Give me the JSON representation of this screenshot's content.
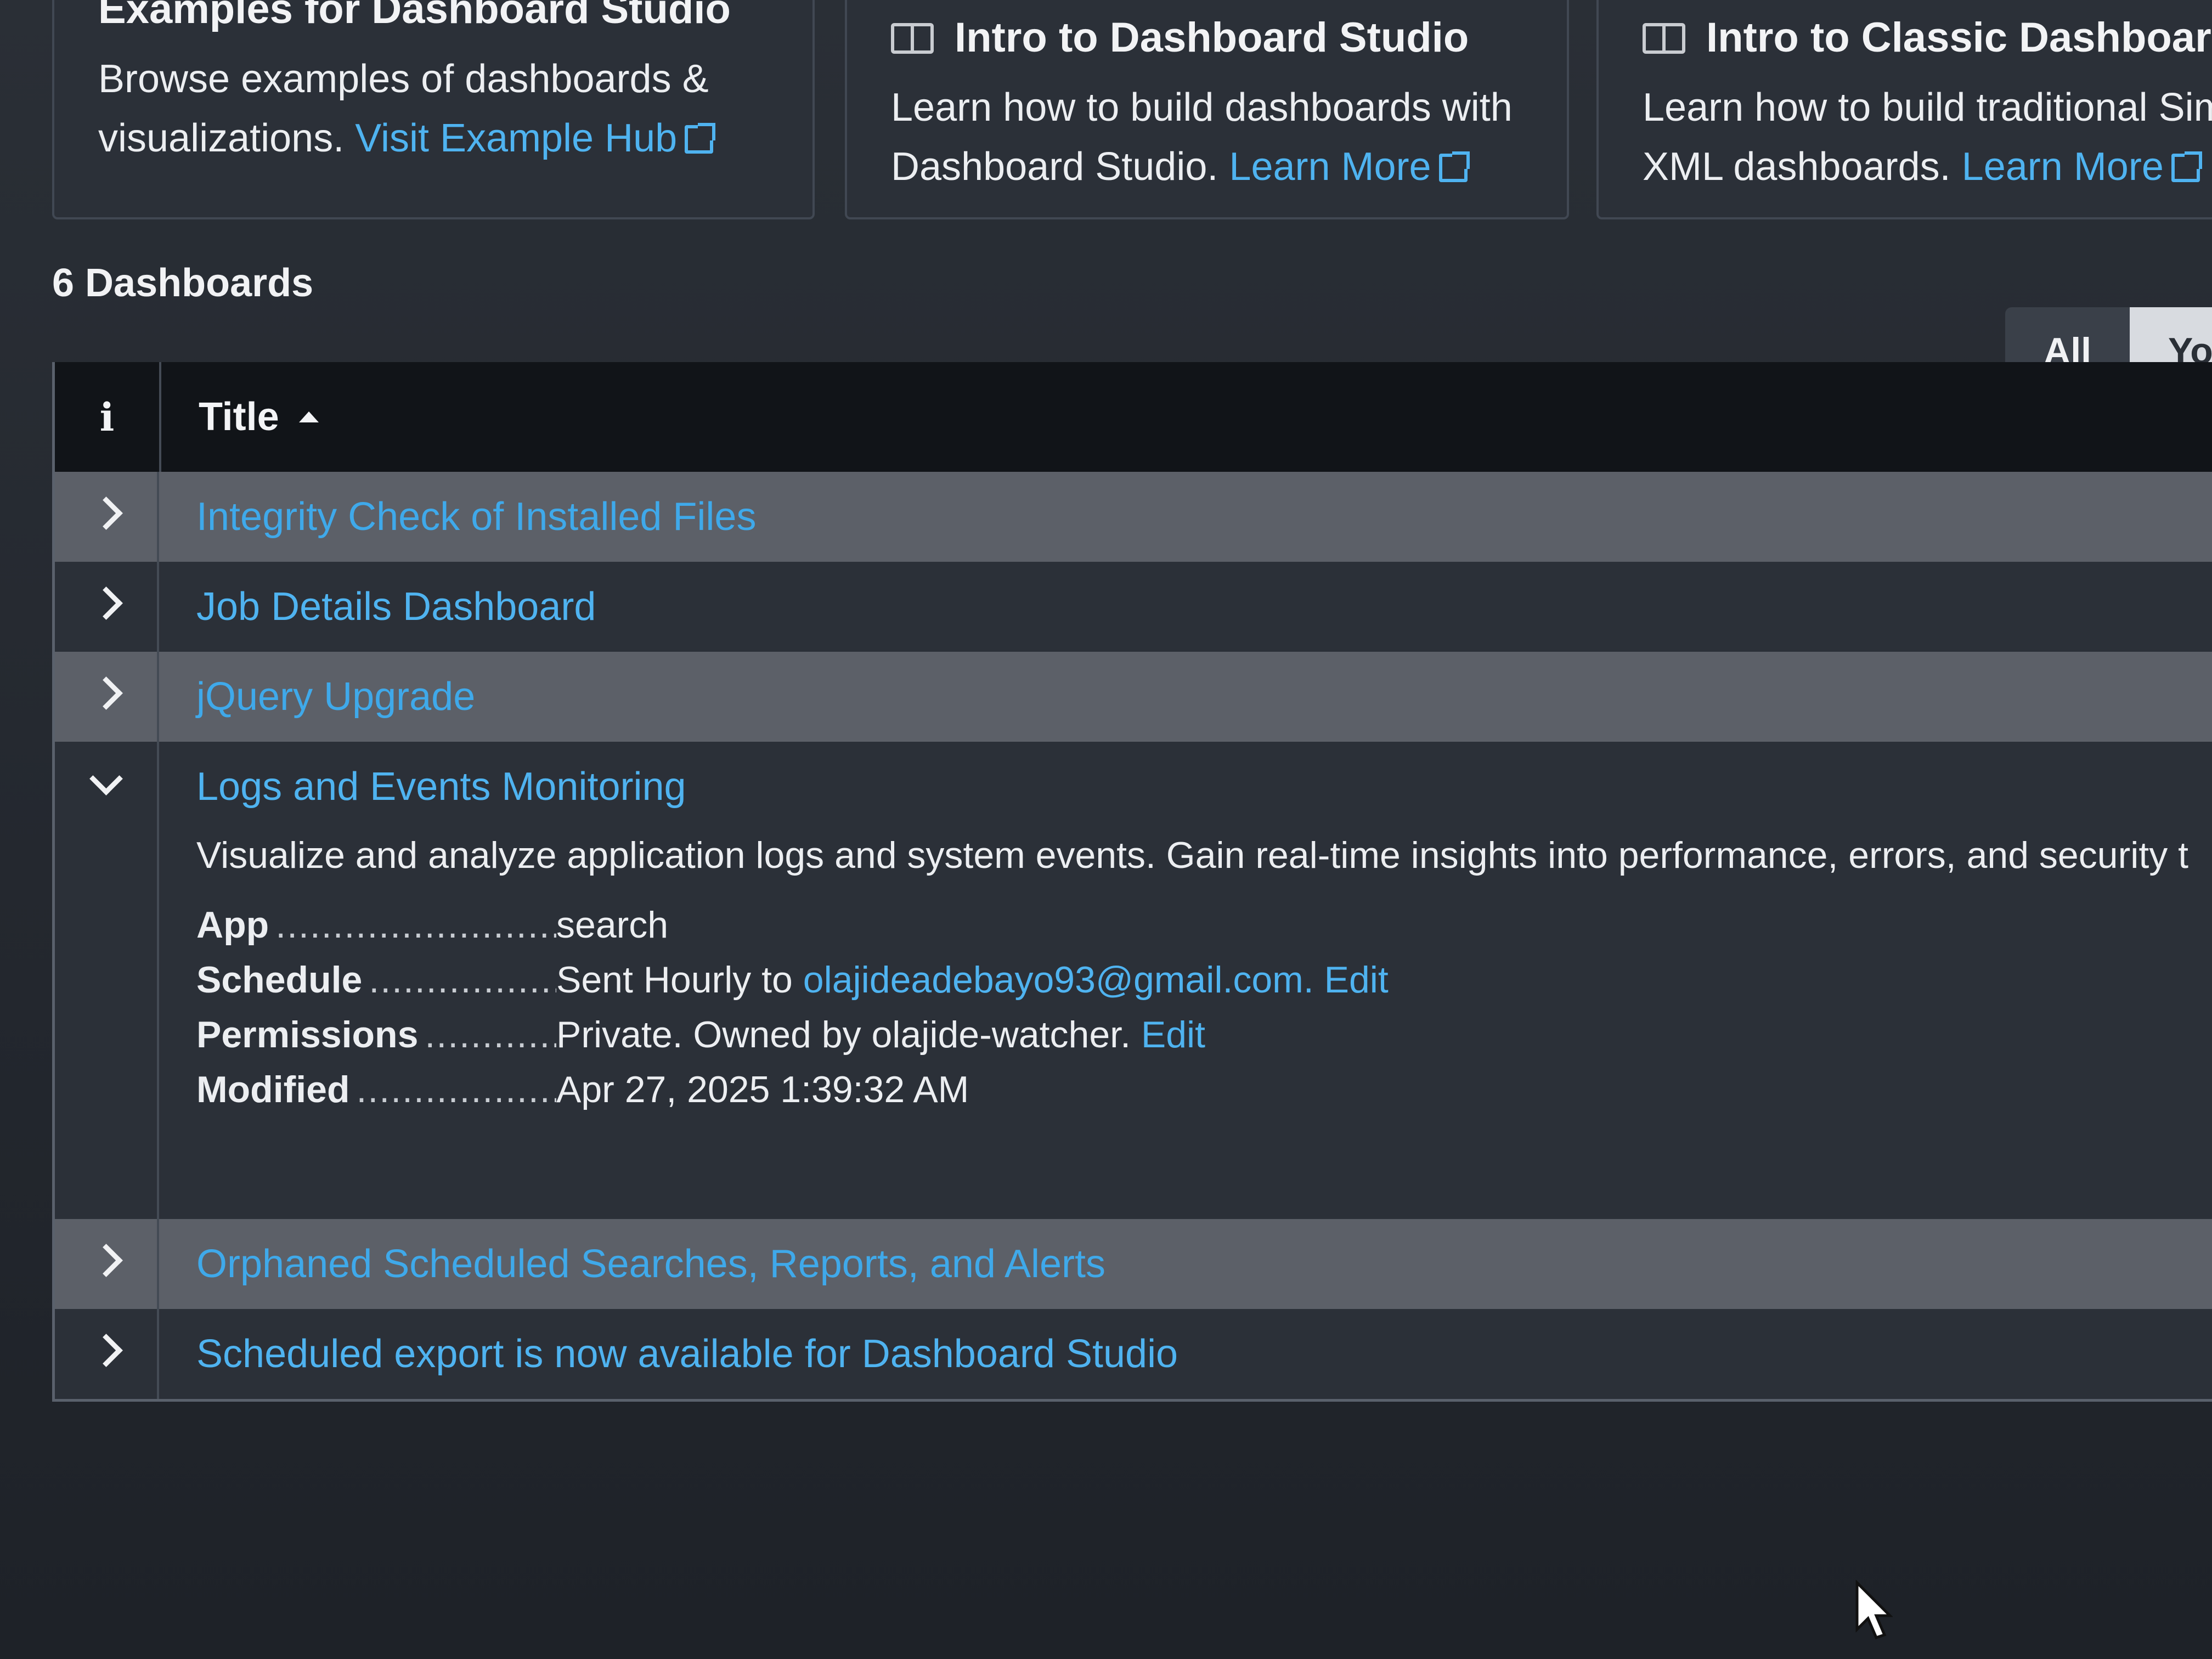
{
  "cards": [
    {
      "title": "Examples for Dashboard Studio",
      "desc_line1": "Browse examples of dashboards &",
      "desc_line2": "visualizations.",
      "link": "Visit Example Hub"
    },
    {
      "title": "Intro to Dashboard Studio",
      "desc_line1": "Learn how to build dashboards with",
      "desc_line2": "Dashboard Studio.",
      "link": "Learn More"
    },
    {
      "title": "Intro to Classic Dashboards",
      "desc_line1": "Learn how to build traditional Simple",
      "desc_line2": "XML dashboards.",
      "link": "Learn More"
    }
  ],
  "dashboards_count": "6 Dashboards",
  "filter": {
    "all": "All",
    "yours": "Yours"
  },
  "table": {
    "info_header": "i",
    "title_header": "Title",
    "rows": [
      {
        "title": "Integrity Check of Installed Files"
      },
      {
        "title": "Job Details Dashboard"
      },
      {
        "title": "jQuery Upgrade"
      },
      {
        "title": "Logs and Events Monitoring",
        "description": "Visualize and analyze application logs and system events. Gain real-time insights into performance, errors, and security t",
        "app_label": "App",
        "app_value": "search",
        "schedule_label": "Schedule",
        "schedule_value": "Sent Hourly to",
        "schedule_email": "olajideadebayo93@gmail.com.",
        "schedule_edit": "Edit",
        "permissions_label": "Permissions",
        "permissions_value": "Private. Owned by olajide-watcher.",
        "permissions_edit": "Edit",
        "modified_label": "Modified",
        "modified_value": "Apr 27, 2025 1:39:32 AM"
      },
      {
        "title": "Orphaned Scheduled Searches, Reports, and Alerts"
      },
      {
        "title": "Scheduled export is now available for Dashboard Studio"
      }
    ]
  }
}
